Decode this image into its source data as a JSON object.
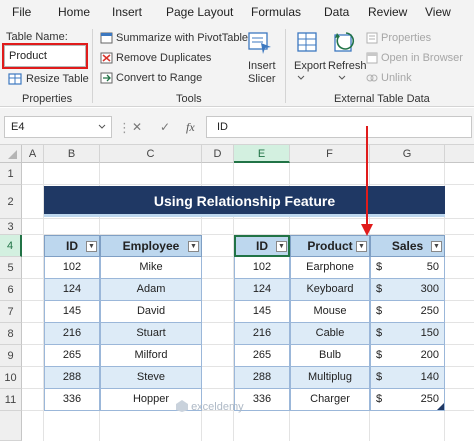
{
  "menu": {
    "items": [
      "File",
      "Home",
      "Insert",
      "Page Layout",
      "Formulas",
      "Data",
      "Review",
      "View"
    ]
  },
  "ribbon": {
    "properties": {
      "label": "Table Name:",
      "value": "Product",
      "resize": "Resize Table",
      "group": "Properties"
    },
    "tools": {
      "summarize": "Summarize with PivotTable",
      "remove_dup": "Remove Duplicates",
      "convert": "Convert to Range",
      "insert_slicer_1": "Insert",
      "insert_slicer_2": "Slicer",
      "group": "Tools"
    },
    "external": {
      "export": "Export",
      "refresh": "Refresh",
      "properties": "Properties",
      "open_browser": "Open in Browser",
      "unlink": "Unlink",
      "group": "External Table Data"
    }
  },
  "formula_bar": {
    "name_box": "E4",
    "cancel": "✕",
    "enter": "✓",
    "fx": "fx",
    "value": "ID"
  },
  "columns": [
    "A",
    "B",
    "C",
    "D",
    "E",
    "F",
    "G"
  ],
  "rows": [
    "1",
    "2",
    "3",
    "4",
    "5",
    "6",
    "7",
    "8",
    "9",
    "10",
    "11"
  ],
  "sheet": {
    "title": "Using Relationship Feature",
    "table1": {
      "headers": [
        "ID",
        "Employee"
      ],
      "rows": [
        [
          "102",
          "Mike"
        ],
        [
          "124",
          "Adam"
        ],
        [
          "145",
          "David"
        ],
        [
          "216",
          "Stuart"
        ],
        [
          "265",
          "Milford"
        ],
        [
          "288",
          "Steve"
        ],
        [
          "336",
          "Hopper"
        ]
      ]
    },
    "table2": {
      "headers": [
        "ID",
        "Product",
        "Sales"
      ],
      "currency": "$",
      "rows": [
        [
          "102",
          "Earphone",
          "50"
        ],
        [
          "124",
          "Keyboard",
          "300"
        ],
        [
          "145",
          "Mouse",
          "250"
        ],
        [
          "216",
          "Cable",
          "150"
        ],
        [
          "265",
          "Bulb",
          "200"
        ],
        [
          "288",
          "Multiplug",
          "140"
        ],
        [
          "336",
          "Charger",
          "250"
        ]
      ]
    }
  },
  "watermark": "exceldemy",
  "colors": {
    "banner": "#1f3864",
    "header": "#bdd7ee",
    "band": "#ddebf7",
    "highlight": "#e01b1b",
    "excel_green": "#217346"
  }
}
